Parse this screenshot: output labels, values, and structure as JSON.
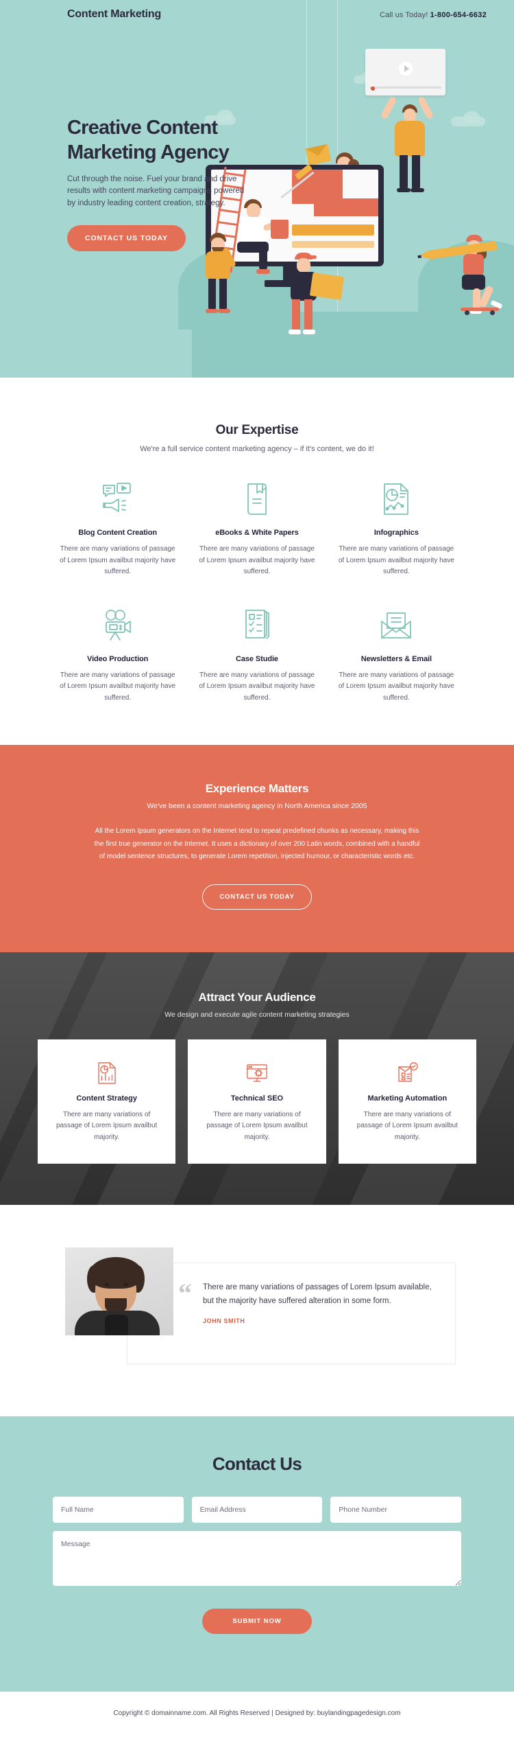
{
  "header": {
    "brand": "Content Marketing",
    "call_label": "Call us Today!",
    "phone": "1-800-654-6632"
  },
  "hero": {
    "heading_line1": "Creative Content",
    "heading_line2": "Marketing Agency",
    "subtext": "Cut through the noise. Fuel your brand and drive results with content marketing campaigns powered by industry leading content creation, strategy.",
    "cta_label": "CONTACT US TODAY"
  },
  "expertise": {
    "title": "Our Expertise",
    "subtitle": "We're a full service content marketing agency – if it's content, we do it!",
    "body_text": "There are many variations of passage of Lorem Ipsum availbut majority have suffered.",
    "items": [
      {
        "icon": "blog-content-icon",
        "title": "Blog Content Creation",
        "text": "There are many variations of passage of Lorem Ipsum availbut majority have suffered."
      },
      {
        "icon": "ebook-icon",
        "title": "eBooks & White Papers",
        "text": "There are many variations of passage of Lorem Ipsum availbut majority have suffered."
      },
      {
        "icon": "infographics-icon",
        "title": "Infographics",
        "text": "There are many variations of passage of Lorem Ipsum availbut majority have suffered."
      },
      {
        "icon": "video-camera-icon",
        "title": "Video Production",
        "text": "There are many variations of passage of Lorem Ipsum availbut majority have suffered."
      },
      {
        "icon": "case-study-icon",
        "title": "Case Studie",
        "text": "There are many variations of passage of Lorem Ipsum availbut majority have suffered."
      },
      {
        "icon": "newsletter-envelope-icon",
        "title": "Newsletters & Email",
        "text": "There are many variations of passage of Lorem Ipsum availbut majority have suffered."
      }
    ]
  },
  "experience": {
    "title": "Experience Matters",
    "subtitle": "We've been a content marketing agency in North America since 2005",
    "body": "All the Lorem Ipsum generators on the Internet tend to repeat predefined chunks as necessary, making this the first true generator on the Internet. It uses a dictionary of over 200 Latin words, combined with a handful of model sentence structures, to generate Lorem repetition, injected humour, or characteristic words etc.",
    "cta_label": "CONTACT US TODAY"
  },
  "attract": {
    "title": "Attract Your Audience",
    "subtitle": "We design and execute agile content marketing strategies",
    "cards": [
      {
        "icon": "content-strategy-icon",
        "title": "Content Strategy",
        "text": "There are many variations of passage of Lorem Ipsum availbut majority."
      },
      {
        "icon": "technical-seo-icon",
        "title": "Technical SEO",
        "text": "There are many variations of passage of Lorem Ipsum availbut majority."
      },
      {
        "icon": "marketing-automation-icon",
        "title": "Marketing Automation",
        "text": "There are many variations of passage of Lorem Ipsum availbut majority."
      }
    ]
  },
  "testimonial": {
    "quote_mark": "“",
    "text": "There are many variations of passages of Lorem Ipsum available, but the majority have suffered alteration in some form.",
    "author": "JOHN SMITH"
  },
  "contact": {
    "title": "Contact Us",
    "fields": {
      "full_name_placeholder": "Full Name",
      "full_name_value": "",
      "email_placeholder": "Email Address",
      "email_value": "",
      "phone_placeholder": "Phone Number",
      "phone_value": "",
      "message_placeholder": "Message",
      "message_value": ""
    },
    "submit_label": "SUBMIT NOW"
  },
  "footer": {
    "text": "Copyright © domainname.com. All Rights Reserved | Designed by: buylandingpagedesign.com"
  },
  "colors": {
    "teal": "#a5d6d0",
    "orange": "#e46f57",
    "dark": "#3a3a3a",
    "ink": "#2b2b3d",
    "icon_teal": "#7cc2b5",
    "icon_orange": "#e8705a"
  }
}
